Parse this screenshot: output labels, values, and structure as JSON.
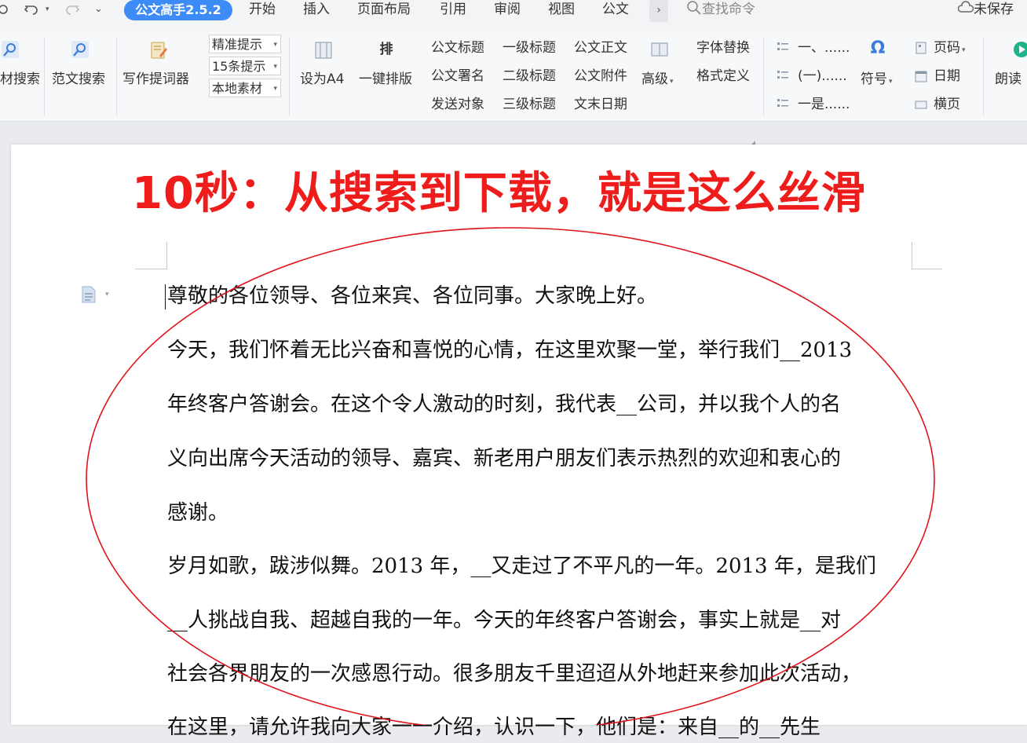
{
  "menubar": {
    "quick_access": {
      "undo_icon": "undo-icon",
      "redo_icon": "redo-icon",
      "customize_icon": "chevron-down-icon"
    },
    "addin_tab": "公文高手2.5.2",
    "tabs": [
      "开始",
      "插入",
      "页面布局",
      "引用",
      "审阅",
      "视图",
      "公文"
    ],
    "more": "›",
    "search_placeholder": "查找命令",
    "save_status": "未保存"
  },
  "ribbon": {
    "material_search": "材搜索",
    "sample_search": "范文搜索",
    "writing_prompter": "写作提词器",
    "dropdowns": [
      "精准提示",
      "15条提示",
      "本地素材"
    ],
    "set_a4": "设为A4",
    "one_key_layout": "一键排版",
    "one_key_layout_glyph": "排",
    "col1": [
      "公文标题",
      "公文署名",
      "发送对象"
    ],
    "col2": [
      "一级标题",
      "二级标题",
      "三级标题"
    ],
    "col3": [
      "公文正文",
      "公文附件",
      "文末日期"
    ],
    "advanced": "高级",
    "font_replace": "字体替换",
    "format_define": "格式定义",
    "numbering": [
      "一、......",
      "(一)......",
      "一是......"
    ],
    "symbol": "符号",
    "symbol_glyph": "Ω",
    "page_number": "页码",
    "date": "日期",
    "landscape": "横页",
    "read_aloud": "朗读"
  },
  "document": {
    "headline": "10秒：从搜索到下载，就是这么丝滑",
    "lines": [
      "尊敬的各位领导、各位来宾、各位同事。大家晚上好。",
      "今天，我们怀着无比兴奋和喜悦的心情，在这里欢聚一堂，举行我们__2013",
      "年终客户答谢会。在这个令人激动的时刻，我代表__公司，并以我个人的名",
      "义向出席今天活动的领导、嘉宾、新老用户朋友们表示热烈的欢迎和衷心的",
      "感谢。",
      "岁月如歌，跋涉似舞。2013 年，__又走过了不平凡的一年。2013 年，是我们",
      "__人挑战自我、超越自我的一年。今天的年终客户答谢会，事实上就是__对",
      "社会各界朋友的一次感恩行动。很多朋友千里迢迢从外地赶来参加此次活动，",
      "在这里，请允许我向大家一一介绍，认识一下，他们是：来自__的__先生"
    ]
  },
  "colors": {
    "accent": "#3c8bf6",
    "headline": "#ef1c1c",
    "annotation": "#e0141c"
  }
}
